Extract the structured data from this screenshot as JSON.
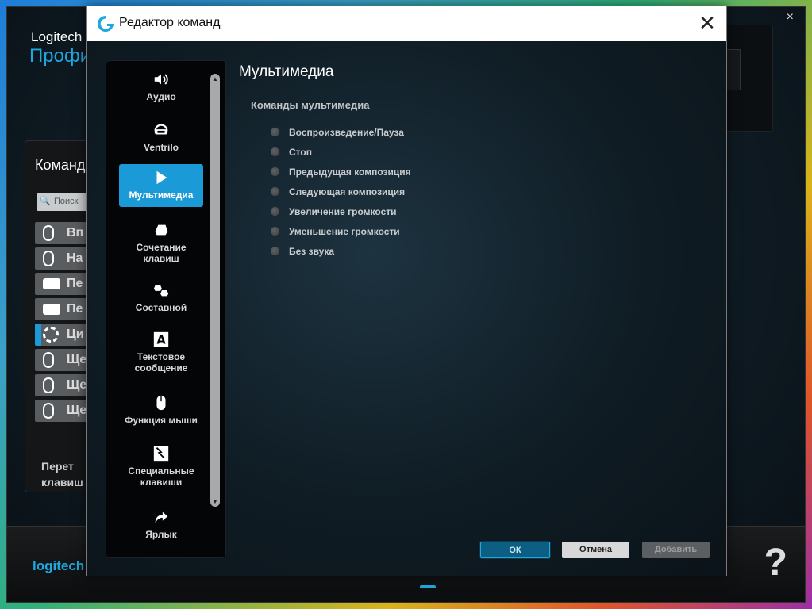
{
  "background": {
    "brand": "Logitech",
    "profile": "Профи",
    "commands_title": "Команд",
    "search_placeholder": "Поиск",
    "rows": [
      {
        "text": "Вп",
        "icon": "mouse-icon"
      },
      {
        "text": "На",
        "icon": "mouse-icon"
      },
      {
        "text": "Пе",
        "icon": "keyboard-key-icon"
      },
      {
        "text": "Пе",
        "icon": "keyboard-key-icon"
      },
      {
        "text": "Ци",
        "icon": "gear-icon"
      },
      {
        "text": "Ще",
        "icon": "mouse-icon"
      },
      {
        "text": "Ще",
        "icon": "mouse-icon"
      },
      {
        "text": "Ще",
        "icon": "mouse-icon"
      }
    ],
    "bottom_text_1": "Перет",
    "bottom_text_2": "клавиш",
    "footer_logo": "logitech",
    "help": "?",
    "close": "×"
  },
  "dialog": {
    "title": "Редактор команд",
    "close_symbol": "✕",
    "categories": [
      {
        "label": "Аудио",
        "icon": "speaker-icon"
      },
      {
        "label": "Ventrilo",
        "icon": "headset-icon"
      },
      {
        "label": "Мультимедиа",
        "icon": "play-icon"
      },
      {
        "label": "Сочетание клавиш",
        "icon": "key-icon"
      },
      {
        "label": "Составной",
        "icon": "multi-key-icon"
      },
      {
        "label": "Текстовое сообщение",
        "icon": "text-a-icon"
      },
      {
        "label": "Функция мыши",
        "icon": "mouse-icon"
      },
      {
        "label": "Специальные клавиши",
        "icon": "special-key-icon"
      },
      {
        "label": "Ярлык",
        "icon": "shortcut-arrow-icon"
      }
    ],
    "active_category": "Мультимедиа",
    "section_title": "Мультимедиа",
    "group_label": "Команды мультимедиа",
    "options": [
      "Воспроизведение/Пауза",
      "Стоп",
      "Предыдущая композиция",
      "Следующая композиция",
      "Увеличение громкости",
      "Уменьшение громкости",
      "Без звука"
    ],
    "buttons": {
      "ok": "ОК",
      "cancel": "Отмена",
      "add": "Добавить"
    },
    "colors": {
      "accent": "#1a9ad6",
      "logo": "#1fa7e0"
    }
  }
}
